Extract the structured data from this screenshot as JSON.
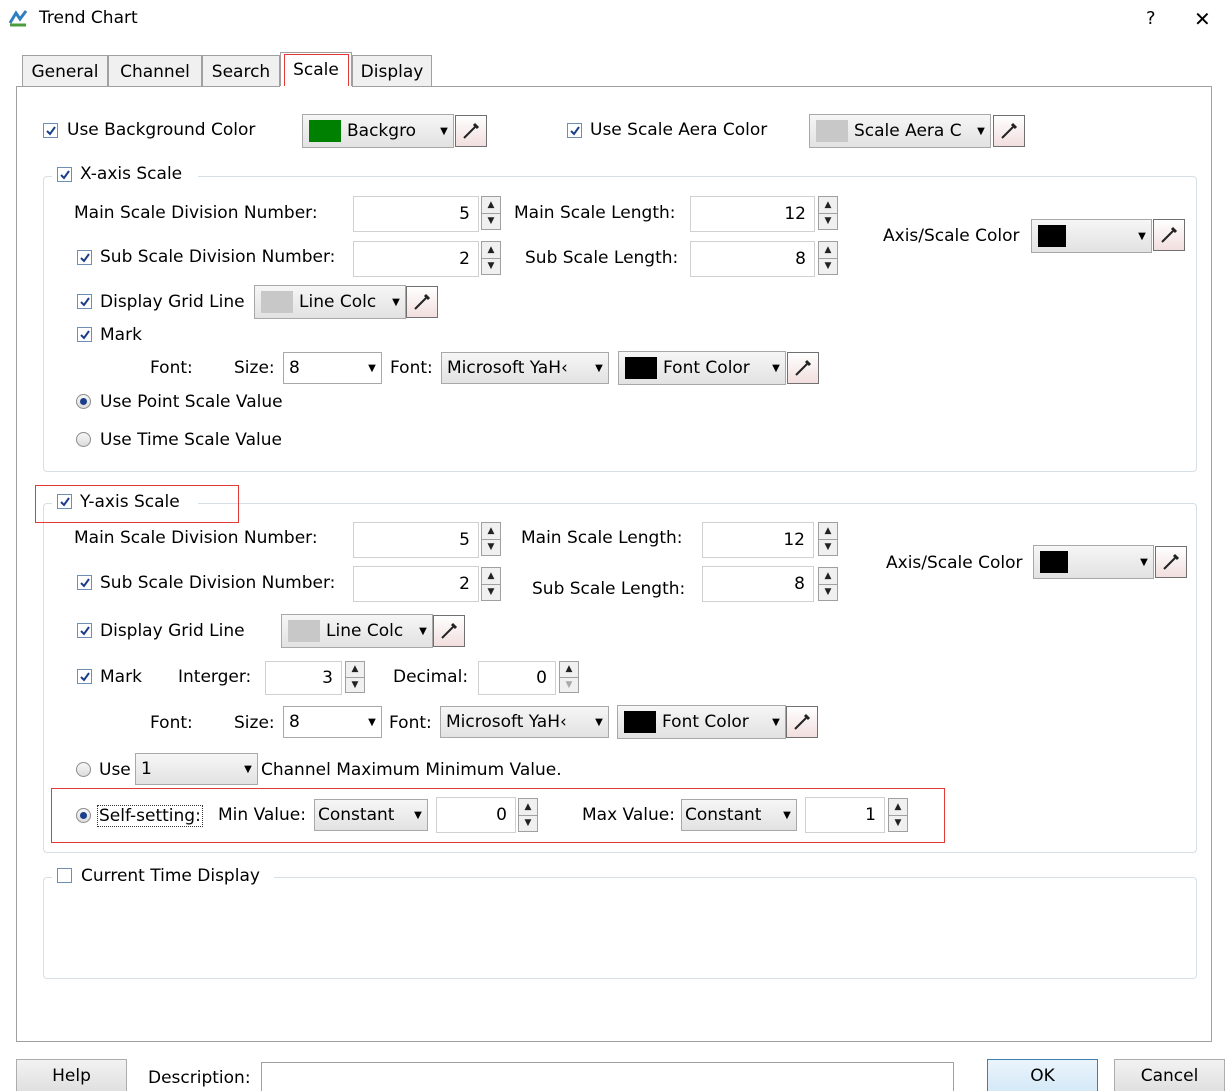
{
  "window": {
    "title": "Trend Chart",
    "help_glyph": "?",
    "close_glyph": "✕",
    "app_icon": "trend-chart-app-icon"
  },
  "tabs": [
    {
      "label": "General"
    },
    {
      "label": "Channel"
    },
    {
      "label": "Search"
    },
    {
      "label": "Scale"
    },
    {
      "label": "Display"
    }
  ],
  "background": {
    "use_bg_label": "Use Background Color",
    "bg_combo": "Backgro",
    "bg_color": "#008000",
    "use_scale_area_label": "Use Scale Aera Color",
    "scale_area_combo": "Scale Aera C",
    "scale_area_color": "#c8c8c8"
  },
  "x_axis": {
    "title": "X-axis Scale",
    "main_div_label": "Main Scale Division Number:",
    "main_div_value": "5",
    "main_len_label": "Main Scale Length:",
    "main_len_value": "12",
    "sub_div_label": "Sub Scale Division Number:",
    "sub_div_value": "2",
    "sub_len_label": "Sub Scale Length:",
    "sub_len_value": "8",
    "axis_color_label": "Axis/Scale Color",
    "axis_color": "#000000",
    "grid_label": "Display Grid Line",
    "grid_combo": "Line Colc",
    "grid_color": "#c8c8c8",
    "mark_label": "Mark",
    "font_label": "Font:",
    "size_label": "Size:",
    "size_value": "8",
    "font2_label": "Font:",
    "font_value": "Microsoft YaH‹",
    "font_color_combo": "Font Color",
    "font_color": "#000000",
    "point_scale_label": "Use Point Scale Value",
    "time_scale_label": "Use Time Scale Value"
  },
  "y_axis": {
    "title": "Y-axis Scale",
    "main_div_label": "Main Scale Division Number:",
    "main_div_value": "5",
    "main_len_label": "Main Scale Length:",
    "main_len_value": "12",
    "sub_div_label": "Sub Scale Division Number:",
    "sub_div_value": "2",
    "sub_len_label": "Sub Scale Length:",
    "sub_len_value": "8",
    "axis_color_label": "Axis/Scale Color",
    "axis_color": "#000000",
    "grid_label": "Display Grid Line",
    "grid_combo": "Line Colc",
    "grid_color": "#c8c8c8",
    "mark_label": "Mark",
    "integer_label": "Interger:",
    "integer_value": "3",
    "decimal_label": "Decimal:",
    "decimal_value": "0",
    "font_label": "Font:",
    "size_label": "Size:",
    "size_value": "8",
    "font2_label": "Font:",
    "font_value": "Microsoft YaH‹",
    "font_color_combo": "Font Color",
    "font_color": "#000000",
    "use_label": "Use",
    "use_value": "1",
    "channel_label": "Channel Maximum Minimum Value.",
    "self_setting_label": "Self-setting:",
    "min_label": "Min Value:",
    "min_mode": "Constant",
    "min_value": "0",
    "max_label": "Max Value:",
    "max_mode": "Constant",
    "max_value": "1"
  },
  "current_time": {
    "label": "Current Time Display"
  },
  "footer": {
    "help": "Help",
    "description_label": "Description:",
    "description_value": "",
    "ok": "OK",
    "cancel": "Cancel"
  },
  "highlight_color": "#e53935"
}
